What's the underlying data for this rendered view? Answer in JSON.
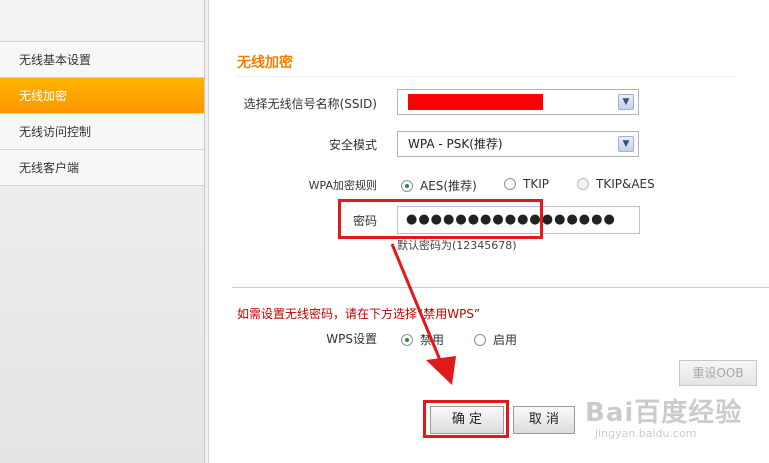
{
  "sidebar": {
    "items": [
      {
        "label": "无线基本设置"
      },
      {
        "label": "无线加密"
      },
      {
        "label": "无线访问控制"
      },
      {
        "label": "无线客户端"
      }
    ]
  },
  "main": {
    "title": "无线加密",
    "ssid": {
      "label": "选择无线信号名称(SSID)"
    },
    "security_mode": {
      "label": "安全模式",
      "value": "WPA - PSK(推荐)"
    },
    "wpa_rule": {
      "label": "WPA加密规则",
      "options": [
        "AES(推荐)",
        "TKIP",
        "TKIP&AES"
      ]
    },
    "password": {
      "label": "密码",
      "value": "●●●●●●●●●●●●●●●●●",
      "hint": "默认密码为(12345678)"
    },
    "wps_note": "如需设置无线密码，请在下方选择“禁用WPS”",
    "wps": {
      "label": "WPS设置",
      "options": [
        "禁用",
        "启用"
      ]
    },
    "reset_oob": "重设OOB",
    "confirm": "确 定",
    "cancel": "取 消"
  },
  "watermark": {
    "main": "Bai百度经验",
    "sub": "jingyan.baidu.com"
  },
  "colors": {
    "accent": "#ff9f00",
    "annotation": "#e0191b",
    "title": "#f08200"
  }
}
